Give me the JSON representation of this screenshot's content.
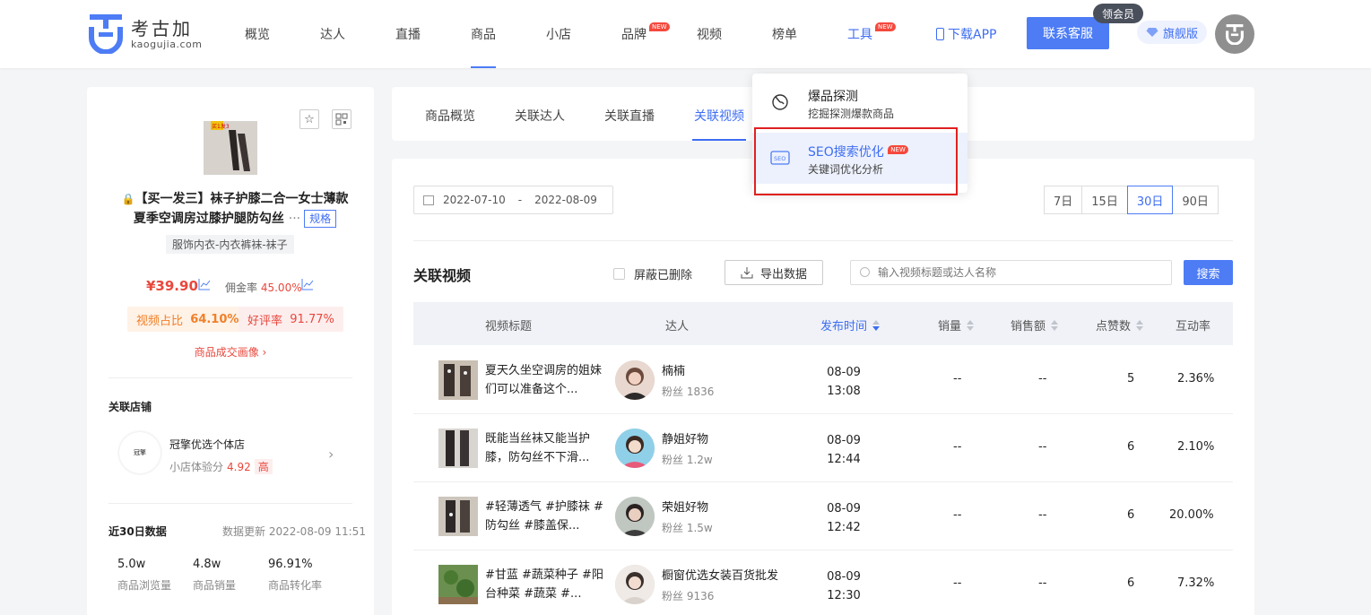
{
  "header": {
    "logo_name": "考古加",
    "logo_domain": "kaogujia.com",
    "nav": [
      {
        "label": "概览"
      },
      {
        "label": "达人"
      },
      {
        "label": "直播"
      },
      {
        "label": "商品"
      },
      {
        "label": "小店"
      },
      {
        "label": "品牌",
        "badge": "NEW"
      },
      {
        "label": "视频"
      },
      {
        "label": "榜单"
      },
      {
        "label": "工具",
        "badge": "NEW"
      }
    ],
    "download_app": "下载APP",
    "contact": "联系客服",
    "member_tag": "领会员",
    "flagship": "旗舰版"
  },
  "product": {
    "thumb_text": "买1发3",
    "title_line1": "【买一发三】袜子护膝二合一女士薄款",
    "title_line2": "夏季空调房过膝护腿防勾丝",
    "more": "···",
    "spec": "规格",
    "category": "服饰内衣-内衣裤袜-袜子",
    "price": "¥39.90",
    "commission_label": "佣金率",
    "commission_value": "45.00%",
    "video_share_label": "视频占比",
    "video_share_value": "64.10%",
    "good_rate_label": "好评率",
    "good_rate_value": "91.77%",
    "portrait_link": "商品成交画像 ›"
  },
  "shop": {
    "section": "关联店铺",
    "logo_text": "冠擎",
    "name": "冠擎优选个体店",
    "score_label": "小店体验分",
    "score": "4.92",
    "level": "高"
  },
  "recent": {
    "section": "近30日数据",
    "update": "数据更新 2022-08-09 11:51",
    "stats": [
      {
        "value": "5.0w",
        "label": "商品浏览量"
      },
      {
        "value": "4.8w",
        "label": "商品销量"
      },
      {
        "value": "96.91%",
        "label": "商品转化率"
      }
    ]
  },
  "tabs": [
    "商品概览",
    "关联达人",
    "关联直播",
    "关联视频"
  ],
  "dropdown": {
    "items": [
      {
        "title": "爆品探测",
        "sub": "挖掘探测爆款商品"
      },
      {
        "title": "SEO搜索优化",
        "badge": "NEW",
        "sub": "关键词优化分析"
      }
    ]
  },
  "filters": {
    "date_start": "2022-07-10",
    "date_sep": "-",
    "date_end": "2022-08-09",
    "periods": [
      "7日",
      "15日",
      "30日",
      "90日"
    ],
    "active_period": "30日"
  },
  "videos": {
    "title": "关联视频",
    "hide_deleted": "屏蔽已删除",
    "export": "导出数据",
    "search_placeholder": "输入视频标题或达人名称",
    "search_btn": "搜索",
    "columns": [
      "视频标题",
      "达人",
      "发布时间",
      "销量",
      "销售额",
      "点赞数",
      "互动率"
    ],
    "rows": [
      {
        "title": "夏天久坐空调房的姐妹们可以准备这个...",
        "name": "楠楠",
        "fans_label": "粉丝",
        "fans": "1836",
        "date": "08-09",
        "time": "13:08",
        "sales": "--",
        "revenue": "--",
        "likes": "5",
        "rate": "2.36%"
      },
      {
        "title": "既能当丝袜又能当护膝，防勾丝不下滑...",
        "name": "静姐好物",
        "fans_label": "粉丝",
        "fans": "1.2w",
        "date": "08-09",
        "time": "12:44",
        "sales": "--",
        "revenue": "--",
        "likes": "6",
        "rate": "2.10%"
      },
      {
        "title": "#轻薄透气 #护膝袜 #防勾丝 #膝盖保...",
        "name": "荣姐好物",
        "fans_label": "粉丝",
        "fans": "1.5w",
        "date": "08-09",
        "time": "12:42",
        "sales": "--",
        "revenue": "--",
        "likes": "6",
        "rate": "20.00%"
      },
      {
        "title": "#甘蓝 #蔬菜种子 #阳台种菜 #蔬菜 #...",
        "name": "橱窗优选女装百货批发",
        "fans_label": "粉丝",
        "fans": "9136",
        "date": "08-09",
        "time": "12:30",
        "sales": "--",
        "revenue": "--",
        "likes": "6",
        "rate": "7.32%"
      }
    ]
  },
  "colors": {
    "accent": "#4d7cf5",
    "red": "#e8483d",
    "orange": "#f0802a",
    "highlight_box": "#e02020"
  }
}
